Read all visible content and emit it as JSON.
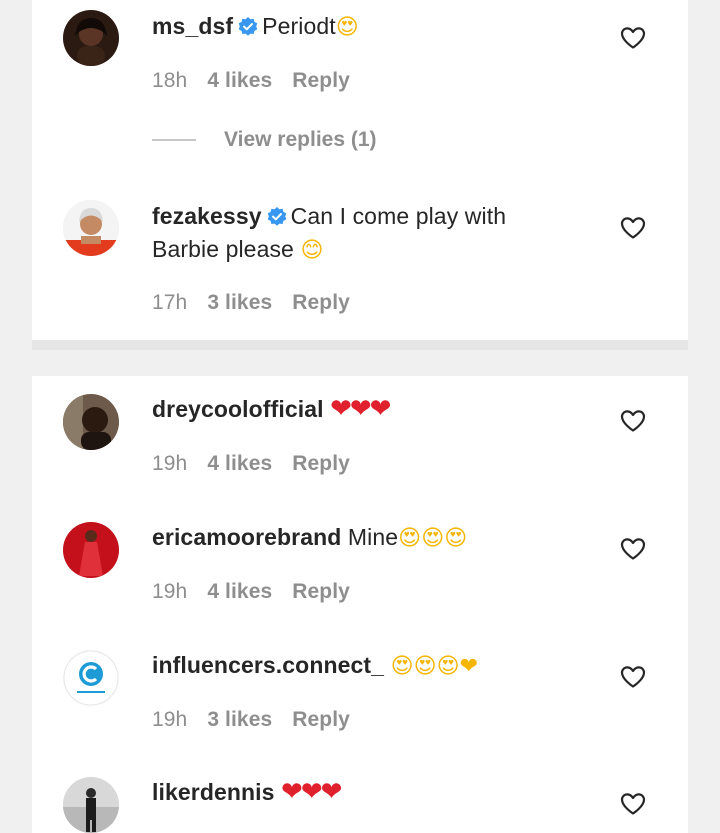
{
  "comments": [
    {
      "username": "ms_dsf",
      "verified": true,
      "text": "Periodt",
      "emoji": "😍",
      "time": "18h",
      "likes": "4 likes",
      "reply": "Reply",
      "view_replies": "View replies (1)"
    },
    {
      "username": "fezakessy",
      "verified": true,
      "text": "Can I come play with Barbie please",
      "emoji": "😊",
      "time": "17h",
      "likes": "3 likes",
      "reply": "Reply"
    },
    {
      "username": "dreycoolofficial",
      "text": "",
      "emoji": "❤❤❤",
      "time": "19h",
      "likes": "4 likes",
      "reply": "Reply"
    },
    {
      "username": "ericamoorebrand",
      "text": "Mine",
      "emoji": "😍😍😍",
      "time": "19h",
      "likes": "4 likes",
      "reply": "Reply"
    },
    {
      "username": "influencers.connect_",
      "text": "",
      "emoji": "😍😍😍❤",
      "time": "19h",
      "likes": "3 likes",
      "reply": "Reply"
    },
    {
      "username": "likerdennis",
      "text": "",
      "emoji": "❤❤❤"
    }
  ],
  "icons": {
    "verified_badge": "verified-badge-icon",
    "like_button": "heart-outline-icon"
  },
  "colors": {
    "verified_blue": "#3897f0",
    "heart_red": "#e0202c",
    "meta_gray": "#8e8e8e"
  }
}
